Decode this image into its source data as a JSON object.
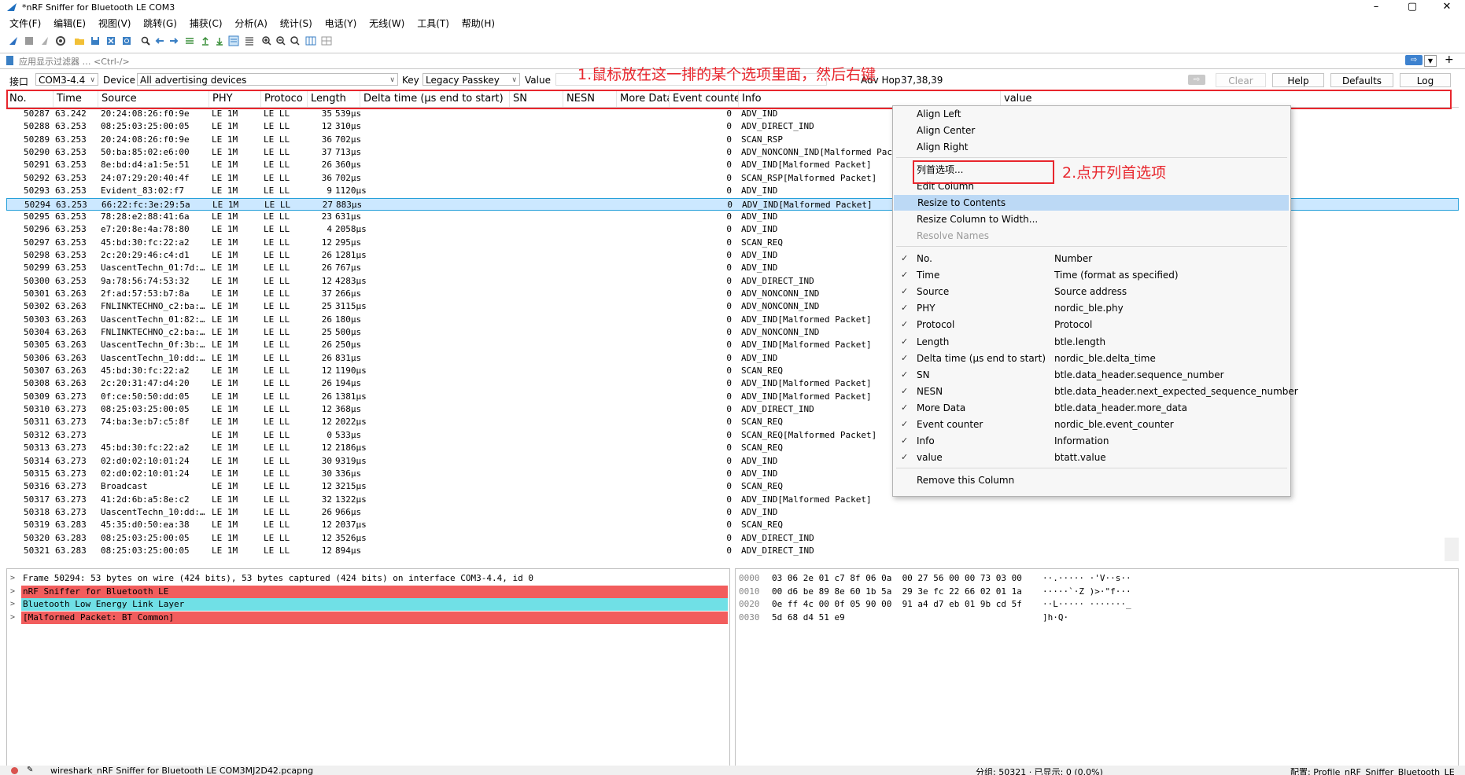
{
  "window": {
    "title": "*nRF Sniffer for Bluetooth LE COM3",
    "minimize": "–",
    "maximize": "▢",
    "close": "✕"
  },
  "menu": [
    "文件(F)",
    "编辑(E)",
    "视图(V)",
    "跳转(G)",
    "捕获(C)",
    "分析(A)",
    "统计(S)",
    "电话(Y)",
    "无线(W)",
    "工具(T)",
    "帮助(H)"
  ],
  "filter": {
    "placeholder": "应用显示过滤器 … <Ctrl-/>",
    "plus": "+"
  },
  "iface": {
    "iface_label": "接口",
    "iface_value": "COM3-4.4",
    "device_label": "Device",
    "device_value": "All advertising devices",
    "key_label": "Key",
    "key_value": "Legacy Passkey",
    "value_label": "Value",
    "adv_hop_label": "Adv Hop",
    "adv_hop_value": "37,38,39",
    "clear": "Clear",
    "help": "Help",
    "defaults": "Defaults",
    "log": "Log"
  },
  "columns": [
    "No.",
    "Time",
    "Source",
    "PHY",
    "Protoco",
    "Length",
    "Delta time (µs end to start)",
    "SN",
    "NESN",
    "More Data",
    "Event counter",
    "Info",
    "value"
  ],
  "packets": [
    [
      "50287",
      "63.242",
      "20:24:08:26:f0:9e",
      "LE 1M",
      "LE LL",
      "35",
      "539µs",
      "0",
      "ADV_IND"
    ],
    [
      "50288",
      "63.253",
      "08:25:03:25:00:05",
      "LE 1M",
      "LE LL",
      "12",
      "310µs",
      "0",
      "ADV_DIRECT_IND"
    ],
    [
      "50289",
      "63.253",
      "20:24:08:26:f0:9e",
      "LE 1M",
      "LE LL",
      "36",
      "702µs",
      "0",
      "SCAN_RSP"
    ],
    [
      "50290",
      "63.253",
      "50:ba:85:02:e6:00",
      "LE 1M",
      "LE LL",
      "37",
      "713µs",
      "0",
      "ADV_NONCONN_IND[Malformed Packet]"
    ],
    [
      "50291",
      "63.253",
      "8e:bd:d4:a1:5e:51",
      "LE 1M",
      "LE LL",
      "26",
      "360µs",
      "0",
      "ADV_IND[Malformed Packet]"
    ],
    [
      "50292",
      "63.253",
      "24:07:29:20:40:4f",
      "LE 1M",
      "LE LL",
      "36",
      "702µs",
      "0",
      "SCAN_RSP[Malformed Packet]"
    ],
    [
      "50293",
      "63.253",
      "Evident_83:02:f7",
      "LE 1M",
      "LE LL",
      "9",
      "1120µs",
      "0",
      "ADV_IND"
    ],
    [
      "50294",
      "63.253",
      "66:22:fc:3e:29:5a",
      "LE 1M",
      "LE LL",
      "27",
      "883µs",
      "0",
      "ADV_IND[Malformed Packet]"
    ],
    [
      "50295",
      "63.253",
      "78:28:e2:88:41:6a",
      "LE 1M",
      "LE LL",
      "23",
      "631µs",
      "0",
      "ADV_IND"
    ],
    [
      "50296",
      "63.253",
      "e7:20:8e:4a:78:80",
      "LE 1M",
      "LE LL",
      "4",
      "2058µs",
      "0",
      "ADV_IND"
    ],
    [
      "50297",
      "63.253",
      "45:bd:30:fc:22:a2",
      "LE 1M",
      "LE LL",
      "12",
      "295µs",
      "0",
      "SCAN_REQ"
    ],
    [
      "50298",
      "63.253",
      "2c:20:29:46:c4:d1",
      "LE 1M",
      "LE LL",
      "26",
      "1281µs",
      "0",
      "ADV_IND"
    ],
    [
      "50299",
      "63.253",
      "UascentTechn_01:7d:…",
      "LE 1M",
      "LE LL",
      "26",
      "767µs",
      "0",
      "ADV_IND"
    ],
    [
      "50300",
      "63.253",
      "9a:78:56:74:53:32",
      "LE 1M",
      "LE LL",
      "12",
      "4283µs",
      "0",
      "ADV_DIRECT_IND"
    ],
    [
      "50301",
      "63.263",
      "2f:ad:57:53:b7:8a",
      "LE 1M",
      "LE LL",
      "37",
      "266µs",
      "0",
      "ADV_NONCONN_IND"
    ],
    [
      "50302",
      "63.263",
      "FNLINKTECHNO_c2:ba:…",
      "LE 1M",
      "LE LL",
      "25",
      "3115µs",
      "0",
      "ADV_NONCONN_IND"
    ],
    [
      "50303",
      "63.263",
      "UascentTechn_01:82:…",
      "LE 1M",
      "LE LL",
      "26",
      "180µs",
      "0",
      "ADV_IND[Malformed Packet]"
    ],
    [
      "50304",
      "63.263",
      "FNLINKTECHNO_c2:ba:…",
      "LE 1M",
      "LE LL",
      "25",
      "500µs",
      "0",
      "ADV_NONCONN_IND"
    ],
    [
      "50305",
      "63.263",
      "UascentTechn_0f:3b:…",
      "LE 1M",
      "LE LL",
      "26",
      "250µs",
      "0",
      "ADV_IND[Malformed Packet]"
    ],
    [
      "50306",
      "63.263",
      "UascentTechn_10:dd:…",
      "LE 1M",
      "LE LL",
      "26",
      "831µs",
      "0",
      "ADV_IND"
    ],
    [
      "50307",
      "63.263",
      "45:bd:30:fc:22:a2",
      "LE 1M",
      "LE LL",
      "12",
      "1190µs",
      "0",
      "SCAN_REQ"
    ],
    [
      "50308",
      "63.263",
      "2c:20:31:47:d4:20",
      "LE 1M",
      "LE LL",
      "26",
      "194µs",
      "0",
      "ADV_IND[Malformed Packet]"
    ],
    [
      "50309",
      "63.273",
      "0f:ce:50:50:dd:05",
      "LE 1M",
      "LE LL",
      "26",
      "1381µs",
      "0",
      "ADV_IND[Malformed Packet]"
    ],
    [
      "50310",
      "63.273",
      "08:25:03:25:00:05",
      "LE 1M",
      "LE LL",
      "12",
      "368µs",
      "0",
      "ADV_DIRECT_IND"
    ],
    [
      "50311",
      "63.273",
      "74:ba:3e:b7:c5:8f",
      "LE 1M",
      "LE LL",
      "12",
      "2022µs",
      "0",
      "SCAN_REQ"
    ],
    [
      "50312",
      "63.273",
      "",
      "LE 1M",
      "LE LL",
      "0",
      "533µs",
      "0",
      "SCAN_REQ[Malformed Packet]"
    ],
    [
      "50313",
      "63.273",
      "45:bd:30:fc:22:a2",
      "LE 1M",
      "LE LL",
      "12",
      "2186µs",
      "0",
      "SCAN_REQ"
    ],
    [
      "50314",
      "63.273",
      "02:d0:02:10:01:24",
      "LE 1M",
      "LE LL",
      "30",
      "9319µs",
      "0",
      "ADV_IND"
    ],
    [
      "50315",
      "63.273",
      "02:d0:02:10:01:24",
      "LE 1M",
      "LE LL",
      "30",
      "336µs",
      "0",
      "ADV_IND"
    ],
    [
      "50316",
      "63.273",
      "Broadcast",
      "LE 1M",
      "LE LL",
      "12",
      "3215µs",
      "0",
      "SCAN_REQ"
    ],
    [
      "50317",
      "63.273",
      "41:2d:6b:a5:8e:c2",
      "LE 1M",
      "LE LL",
      "32",
      "1322µs",
      "0",
      "ADV_IND[Malformed Packet]"
    ],
    [
      "50318",
      "63.273",
      "UascentTechn_10:dd:…",
      "LE 1M",
      "LE LL",
      "26",
      "966µs",
      "0",
      "ADV_IND"
    ],
    [
      "50319",
      "63.283",
      "45:35:d0:50:ea:38",
      "LE 1M",
      "LE LL",
      "12",
      "2037µs",
      "0",
      "SCAN_REQ"
    ],
    [
      "50320",
      "63.283",
      "08:25:03:25:00:05",
      "LE 1M",
      "LE LL",
      "12",
      "3526µs",
      "0",
      "ADV_DIRECT_IND"
    ],
    [
      "50321",
      "63.283",
      "08:25:03:25:00:05",
      "LE 1M",
      "LE LL",
      "12",
      "894µs",
      "0",
      "ADV_DIRECT_IND"
    ]
  ],
  "selected_row": 7,
  "details": [
    {
      "text": "Frame 50294: 53 bytes on wire (424 bits), 53 bytes captured (424 bits) on interface COM3-4.4, id 0",
      "bg": "#ffffff"
    },
    {
      "text": "nRF Sniffer for Bluetooth LE",
      "bg": "#f25d5d"
    },
    {
      "text": "Bluetooth Low Energy Link Layer",
      "bg": "#70e0e6"
    },
    {
      "text": "[Malformed Packet: BT Common]",
      "bg": "#f25d5d"
    }
  ],
  "bytes": [
    {
      "off": "0000",
      "hex": "03 06 2e 01 c7 8f 06 0a  00 27 56 00 00 73 03 00",
      "ascii": "··.····· ·'V··s··"
    },
    {
      "off": "0010",
      "hex": "00 d6 be 89 8e 60 1b 5a  29 3e fc 22 66 02 01 1a",
      "ascii": "·····`·Z )>·\"f···"
    },
    {
      "off": "0020",
      "hex": "0e ff 4c 00 0f 05 90 00  91 a4 d7 eb 01 9b cd 5f",
      "ascii": "··L····· ·······_"
    },
    {
      "off": "0030",
      "hex": "5d 68 d4 51 e9",
      "ascii": "]h·Q·"
    }
  ],
  "context_menu": {
    "align_left": "Align Left",
    "align_center": "Align Center",
    "align_right": "Align Right",
    "column_prefs": "列首选项...",
    "edit_column": "Edit Column",
    "resize_contents": "Resize to Contents",
    "resize_width": "Resize Column to Width...",
    "resolve_names": "Resolve Names",
    "columns": [
      [
        "No.",
        "Number"
      ],
      [
        "Time",
        "Time (format as specified)"
      ],
      [
        "Source",
        "Source address"
      ],
      [
        "PHY",
        "nordic_ble.phy"
      ],
      [
        "Protocol",
        "Protocol"
      ],
      [
        "Length",
        "btle.length"
      ],
      [
        "Delta time (µs end to start)",
        "nordic_ble.delta_time"
      ],
      [
        "SN",
        "btle.data_header.sequence_number"
      ],
      [
        "NESN",
        "btle.data_header.next_expected_sequence_number"
      ],
      [
        "More Data",
        "btle.data_header.more_data"
      ],
      [
        "Event counter",
        "nordic_ble.event_counter"
      ],
      [
        "Info",
        "Information"
      ],
      [
        "value",
        "btatt.value"
      ]
    ],
    "checkmark": "✓",
    "remove_column": "Remove this Column"
  },
  "annotations": {
    "step1": "1.鼠标放在这一排的某个选项里面，然后右键",
    "step2": "2.点开列首选项"
  },
  "status": {
    "file": "wireshark_nRF Sniffer for Bluetooth LE COM3MJ2D42.pcapng",
    "packets": "分组: 50321 · 已显示: 0 (0.0%)",
    "profile": "配置: Profile_nRF_Sniffer_Bluetooth_LE"
  },
  "colors": {
    "accent_red": "#e8262d",
    "selection": "#cce8ff",
    "menu_highlight": "#bcd9f5",
    "malformed_bg": "#f25d5d",
    "btle_bg": "#70e0e6"
  }
}
